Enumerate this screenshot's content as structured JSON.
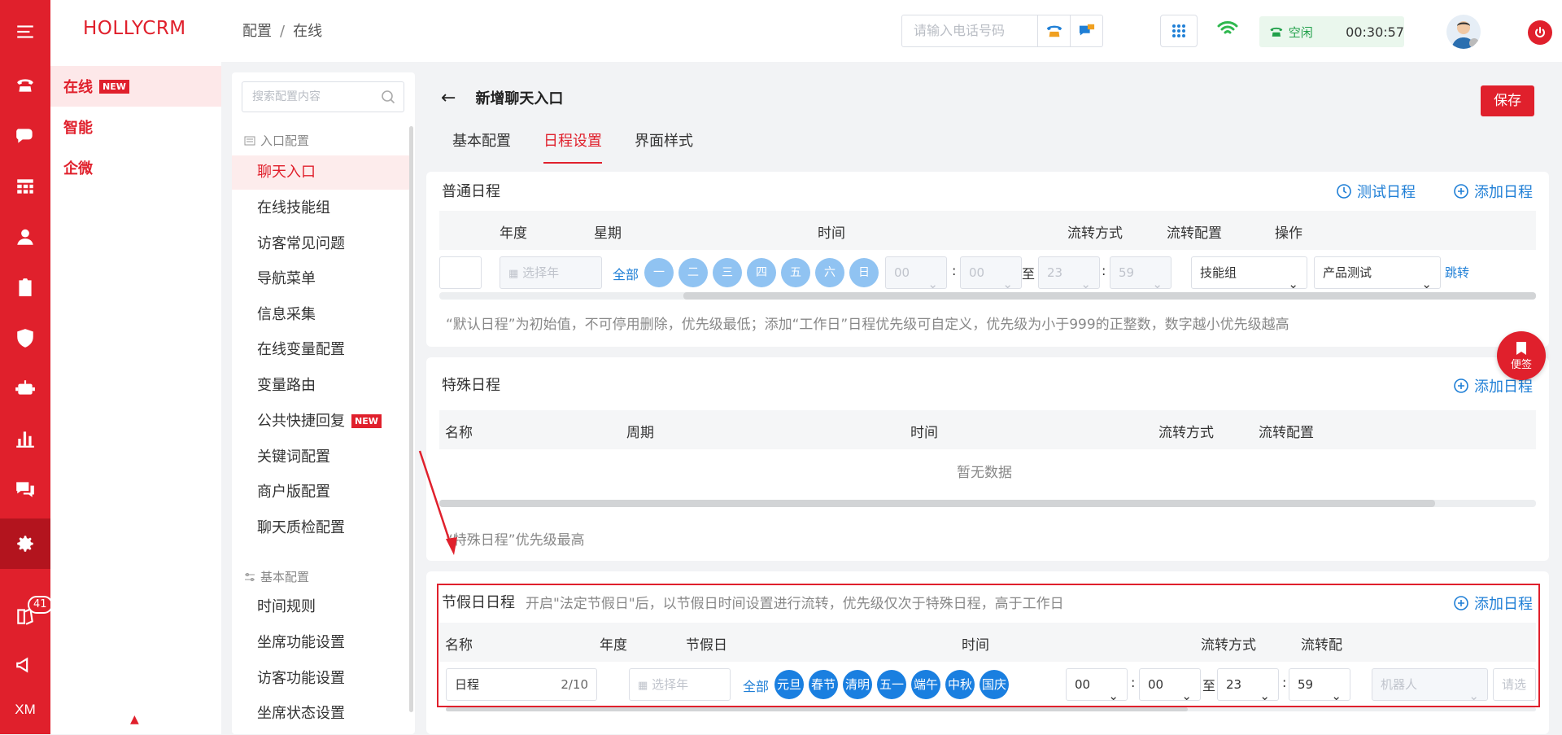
{
  "rail": {
    "badge_count": "41",
    "bottom_label": "XM"
  },
  "brand": {
    "name": "HOLLYCRM"
  },
  "nav1": [
    {
      "label": "在线",
      "tag": "NEW"
    },
    {
      "label": "智能"
    },
    {
      "label": "企微"
    }
  ],
  "breadcrumb": {
    "part1": "配置",
    "sep": "/",
    "part2": "在线"
  },
  "topbar": {
    "phone_placeholder": "请输入电话号码",
    "status_label": "空闲",
    "timer": "00:30:57"
  },
  "side2": {
    "search_placeholder": "搜索配置内容",
    "group1": "入口配置",
    "items": [
      "聊天入口",
      "在线技能组",
      "访客常见问题",
      "导航菜单",
      "信息采集",
      "在线变量配置",
      "变量路由",
      "公共快捷回复",
      "关键词配置",
      "商户版配置",
      "聊天质检配置"
    ],
    "new_tag": "NEW",
    "group2": "基本配置",
    "items2": [
      "时间规则",
      "坐席功能设置",
      "访客功能设置",
      "坐席状态设置"
    ]
  },
  "page": {
    "title": "新增聊天入口",
    "save": "保存",
    "tabs": [
      "基本配置",
      "日程设置",
      "界面样式"
    ]
  },
  "normal": {
    "title": "普通日程",
    "test_btn": "测试日程",
    "add_btn": "添加日程",
    "headers": [
      "年度",
      "星期",
      "时间",
      "流转方式",
      "流转配置",
      "操作"
    ],
    "year_placeholder": "选择年",
    "all": "全部",
    "weekdays": [
      "一",
      "二",
      "三",
      "四",
      "五",
      "六",
      "日"
    ],
    "time": [
      "00",
      "00",
      "23",
      "59"
    ],
    "to": "至",
    "colon": ":",
    "flow_mode": "技能组",
    "flow_config": "产品测试",
    "action": "跳转",
    "note": "“默认日程”为初始值，不可停用删除，优先级最低；添加“工作日”日程优先级可自定义，优先级为小于999的正整数，数字越小优先级越高"
  },
  "special": {
    "title": "特殊日程",
    "add_btn": "添加日程",
    "headers": [
      "名称",
      "周期",
      "时间",
      "流转方式",
      "流转配置"
    ],
    "empty": "暂无数据",
    "note": "“特殊日程”优先级最高"
  },
  "holiday": {
    "title": "节假日日程",
    "desc": "开启\"法定节假日\"后，以节假日时间设置进行流转，优先级仅次于特殊日程，高于工作日",
    "add_btn": "添加日程",
    "headers": [
      "名称",
      "年度",
      "节假日",
      "时间",
      "流转方式",
      "流转配"
    ],
    "name_value": "日程",
    "name_count": "2/10",
    "year_placeholder": "选择年",
    "all": "全部",
    "holidays": [
      "元旦",
      "春节",
      "清明",
      "五一",
      "端午",
      "中秋",
      "国庆"
    ],
    "time": [
      "00",
      "00",
      "23",
      "59"
    ],
    "to": "至",
    "flow_mode": "机器人",
    "flow_config_placeholder": "请选"
  },
  "float_btn": {
    "label": "便签"
  },
  "colors": {
    "brand_red": "#e0202c",
    "link_blue": "#1f7fd6",
    "status_green": "#21a04a"
  }
}
